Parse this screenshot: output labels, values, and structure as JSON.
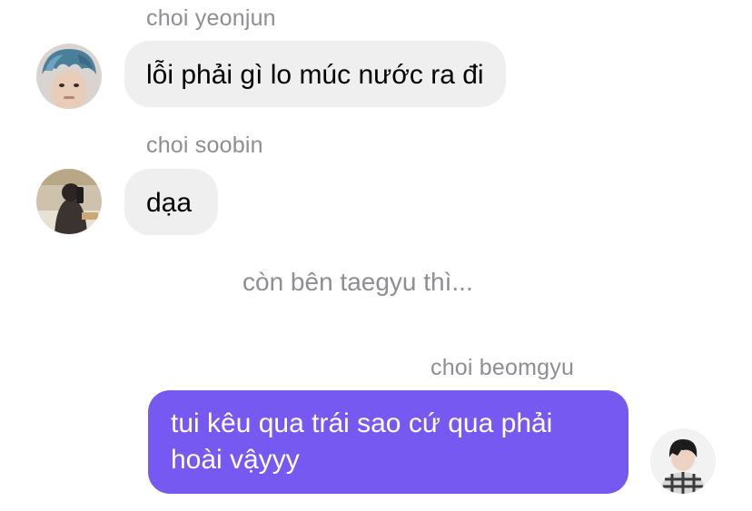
{
  "messages": [
    {
      "sender": "choi yeonjun",
      "text": "lỗi phải gì lo múc nước ra đi",
      "avatar": "blue-haired-boy-avatar"
    },
    {
      "sender": "choi soobin",
      "text": "dạa",
      "avatar": "mirror-selfie-avatar"
    },
    {
      "sender": "choi beomgyu",
      "text_lines": [
        "tui kêu qua trái sao cứ qua phải",
        "hoài vậyyy"
      ],
      "avatar": "plaid-shirt-avatar"
    }
  ],
  "system_text": "còn bên taegyu thì...",
  "colors": {
    "incoming_bubble": "#efefef",
    "outgoing_bubble": "#7659f1",
    "meta_text": "#8e8e93"
  }
}
